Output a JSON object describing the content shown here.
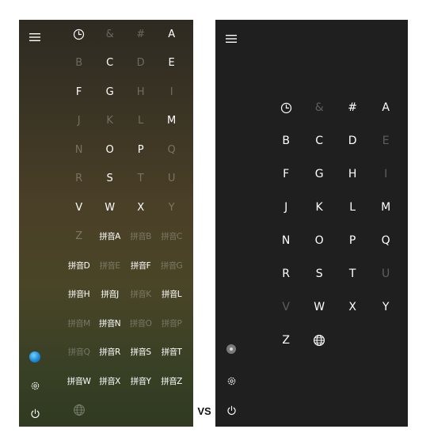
{
  "left": {
    "menu_icon": "hamburger-icon",
    "cells": [
      {
        "kind": "icon",
        "icon": "clock-icon",
        "enabled": true
      },
      {
        "kind": "text",
        "text": "&",
        "enabled": false
      },
      {
        "kind": "text",
        "text": "#",
        "enabled": false
      },
      {
        "kind": "text",
        "text": "A",
        "enabled": true
      },
      {
        "kind": "text",
        "text": "B",
        "enabled": false
      },
      {
        "kind": "text",
        "text": "C",
        "enabled": true
      },
      {
        "kind": "text",
        "text": "D",
        "enabled": false
      },
      {
        "kind": "text",
        "text": "E",
        "enabled": true
      },
      {
        "kind": "text",
        "text": "F",
        "enabled": true
      },
      {
        "kind": "text",
        "text": "G",
        "enabled": true
      },
      {
        "kind": "text",
        "text": "H",
        "enabled": false
      },
      {
        "kind": "text",
        "text": "I",
        "enabled": false
      },
      {
        "kind": "text",
        "text": "J",
        "enabled": false
      },
      {
        "kind": "text",
        "text": "K",
        "enabled": false
      },
      {
        "kind": "text",
        "text": "L",
        "enabled": false
      },
      {
        "kind": "text",
        "text": "M",
        "enabled": true
      },
      {
        "kind": "text",
        "text": "N",
        "enabled": false
      },
      {
        "kind": "text",
        "text": "O",
        "enabled": true
      },
      {
        "kind": "text",
        "text": "P",
        "enabled": true
      },
      {
        "kind": "text",
        "text": "Q",
        "enabled": false
      },
      {
        "kind": "text",
        "text": "R",
        "enabled": false
      },
      {
        "kind": "text",
        "text": "S",
        "enabled": true
      },
      {
        "kind": "text",
        "text": "T",
        "enabled": false
      },
      {
        "kind": "text",
        "text": "U",
        "enabled": false
      },
      {
        "kind": "text",
        "text": "V",
        "enabled": true
      },
      {
        "kind": "text",
        "text": "W",
        "enabled": true
      },
      {
        "kind": "text",
        "text": "X",
        "enabled": true
      },
      {
        "kind": "text",
        "text": "Y",
        "enabled": false
      },
      {
        "kind": "text",
        "text": "Z",
        "enabled": false
      },
      {
        "kind": "text",
        "text": "拼音A",
        "enabled": true
      },
      {
        "kind": "text",
        "text": "拼音B",
        "enabled": false
      },
      {
        "kind": "text",
        "text": "拼音C",
        "enabled": false
      },
      {
        "kind": "text",
        "text": "拼音D",
        "enabled": true
      },
      {
        "kind": "text",
        "text": "拼音E",
        "enabled": false
      },
      {
        "kind": "text",
        "text": "拼音F",
        "enabled": true
      },
      {
        "kind": "text",
        "text": "拼音G",
        "enabled": false
      },
      {
        "kind": "text",
        "text": "拼音H",
        "enabled": true
      },
      {
        "kind": "text",
        "text": "拼音J",
        "enabled": true
      },
      {
        "kind": "text",
        "text": "拼音K",
        "enabled": false
      },
      {
        "kind": "text",
        "text": "拼音L",
        "enabled": true
      },
      {
        "kind": "text",
        "text": "拼音M",
        "enabled": false
      },
      {
        "kind": "text",
        "text": "拼音N",
        "enabled": true
      },
      {
        "kind": "text",
        "text": "拼音O",
        "enabled": false
      },
      {
        "kind": "text",
        "text": "拼音P",
        "enabled": false
      },
      {
        "kind": "text",
        "text": "拼音Q",
        "enabled": false
      },
      {
        "kind": "text",
        "text": "拼音R",
        "enabled": true
      },
      {
        "kind": "text",
        "text": "拼音S",
        "enabled": true
      },
      {
        "kind": "text",
        "text": "拼音T",
        "enabled": true
      },
      {
        "kind": "text",
        "text": "拼音W",
        "enabled": true
      },
      {
        "kind": "text",
        "text": "拼音X",
        "enabled": true
      },
      {
        "kind": "text",
        "text": "拼音Y",
        "enabled": true
      },
      {
        "kind": "text",
        "text": "拼音Z",
        "enabled": true
      },
      {
        "kind": "icon",
        "icon": "globe-icon",
        "enabled": false
      }
    ],
    "rail_bottom_icons": [
      "app-icon",
      "gear-icon",
      "power-icon"
    ]
  },
  "separator_text": "VS",
  "right": {
    "menu_icon": "hamburger-icon",
    "cells": [
      {
        "kind": "icon",
        "icon": "clock-icon",
        "enabled": true
      },
      {
        "kind": "text",
        "text": "&",
        "enabled": false
      },
      {
        "kind": "text",
        "text": "#",
        "enabled": true
      },
      {
        "kind": "text",
        "text": "A",
        "enabled": true
      },
      {
        "kind": "text",
        "text": "B",
        "enabled": true
      },
      {
        "kind": "text",
        "text": "C",
        "enabled": true
      },
      {
        "kind": "text",
        "text": "D",
        "enabled": true
      },
      {
        "kind": "text",
        "text": "E",
        "enabled": false
      },
      {
        "kind": "text",
        "text": "F",
        "enabled": true
      },
      {
        "kind": "text",
        "text": "G",
        "enabled": true
      },
      {
        "kind": "text",
        "text": "H",
        "enabled": true
      },
      {
        "kind": "text",
        "text": "I",
        "enabled": false
      },
      {
        "kind": "text",
        "text": "J",
        "enabled": true
      },
      {
        "kind": "text",
        "text": "K",
        "enabled": true
      },
      {
        "kind": "text",
        "text": "L",
        "enabled": true
      },
      {
        "kind": "text",
        "text": "M",
        "enabled": true
      },
      {
        "kind": "text",
        "text": "N",
        "enabled": true
      },
      {
        "kind": "text",
        "text": "O",
        "enabled": true
      },
      {
        "kind": "text",
        "text": "P",
        "enabled": true
      },
      {
        "kind": "text",
        "text": "Q",
        "enabled": true
      },
      {
        "kind": "text",
        "text": "R",
        "enabled": true
      },
      {
        "kind": "text",
        "text": "S",
        "enabled": true
      },
      {
        "kind": "text",
        "text": "T",
        "enabled": true
      },
      {
        "kind": "text",
        "text": "U",
        "enabled": false
      },
      {
        "kind": "text",
        "text": "V",
        "enabled": false
      },
      {
        "kind": "text",
        "text": "W",
        "enabled": true
      },
      {
        "kind": "text",
        "text": "X",
        "enabled": true
      },
      {
        "kind": "text",
        "text": "Y",
        "enabled": true
      },
      {
        "kind": "text",
        "text": "Z",
        "enabled": true
      },
      {
        "kind": "icon",
        "icon": "globe-icon",
        "enabled": true
      }
    ],
    "rail_bottom_icons": [
      "avatar-icon",
      "gear-icon",
      "power-icon"
    ]
  },
  "colors": {
    "enabled_text": "#ffffff",
    "disabled_text": "rgba(255,255,255,0.28)",
    "left_background": "#4a3f27",
    "right_background": "#1f1f1f"
  }
}
